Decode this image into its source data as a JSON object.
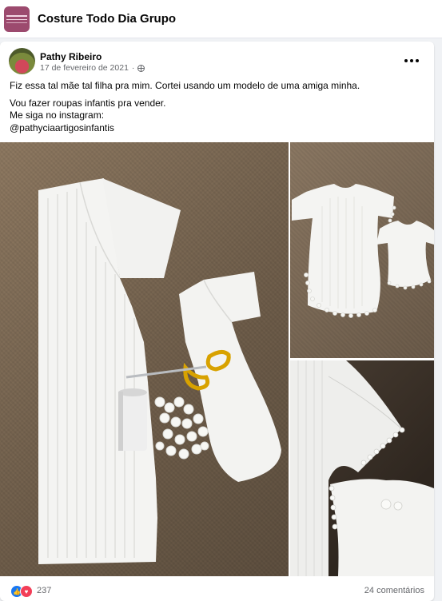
{
  "group": {
    "name": "Costure Todo Dia Grupo",
    "logo_text": "COSTURE TODO DIA"
  },
  "post": {
    "author": "Pathy Ribeiro",
    "date": "17 de fevereiro de 2021",
    "audience_icon": "globe-icon",
    "more_icon": "ellipsis-icon",
    "text": {
      "line1": "Fiz essa tal mãe tal filha pra mim. Cortei usando um modelo de uma amiga minha.",
      "line2": "Vou fazer roupas infantis pra vender.",
      "line3": "Me siga no instagram:",
      "line4": "@pathyciaartigosinfantis"
    },
    "photos": [
      "cut-fabric-pieces-with-scissors-and-thread",
      "finished-mother-and-daughter-shirts",
      "shirt-sleeve-detail-with-pompom-trim"
    ]
  },
  "footer": {
    "reaction_count": "237",
    "comment_count": "24 comentários"
  },
  "colors": {
    "text_primary": "#050505",
    "text_secondary": "#65676b",
    "like_blue": "#1877f2",
    "love_red": "#f33e58",
    "page_bg": "#f0f2f5"
  }
}
